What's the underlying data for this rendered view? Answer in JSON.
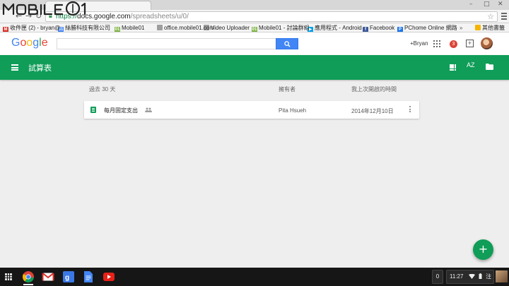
{
  "browser": {
    "url": {
      "scheme": "https://",
      "host": "docs.google.com",
      "path": "/spreadsheets/u/0/"
    },
    "bookmarks": [
      {
        "label": "收件匣 (2) - bryan@",
        "icon": "gmail-icon",
        "color": "#d93025"
      },
      {
        "label": "絲勝科技有限公司",
        "icon": "calendar-icon",
        "color": "#4285f4"
      },
      {
        "label": "Mobile01",
        "icon": "mobile01-icon",
        "color": "#7cb342"
      },
      {
        "label": "office.mobile01.com",
        "icon": "page-icon",
        "color": "#9e9e9e"
      },
      {
        "label": "Video Uploader",
        "icon": "page-icon",
        "color": "#9e9e9e"
      },
      {
        "label": "Mobile01 - 討論群組",
        "icon": "mobile01-icon",
        "color": "#7cb342"
      },
      {
        "label": "應用程式 - Android",
        "icon": "play-icon",
        "color": "#00a0e9"
      },
      {
        "label": "Facebook",
        "icon": "facebook-icon",
        "color": "#3b5998"
      },
      {
        "label": "PChome Online 網路",
        "icon": "pchome-icon",
        "color": "#1a73e8"
      }
    ],
    "bookmarks_overflow": "»",
    "other_bookmarks": "其他書籤"
  },
  "google_bar": {
    "logo": "Google",
    "logo_colors": [
      "#4285f4",
      "#ea4335",
      "#fbbc05",
      "#4285f4",
      "#34a853",
      "#ea4335"
    ],
    "search_placeholder": "",
    "user_link": "+Bryan",
    "notification_count": "3"
  },
  "app_bar": {
    "title": "試算表",
    "accent_color": "#0f9d58",
    "sort_icon_label": "AZ"
  },
  "file_list": {
    "section_label": "過去 30 天",
    "owner_header": "擁有者",
    "last_opened_header": "我上次開啟的時間",
    "files": [
      {
        "title": "每月固定支出",
        "owner": "Pita Hsueh",
        "last_opened": "2014年12月10日",
        "shared": true
      }
    ]
  },
  "fab": {
    "label": "+"
  },
  "shelf": {
    "apps": [
      "chrome-icon",
      "gmail-icon",
      "google-plus-icon",
      "docs-icon",
      "youtube-icon"
    ],
    "notification_count": "0",
    "time": "11:27",
    "ime_label": "注"
  }
}
